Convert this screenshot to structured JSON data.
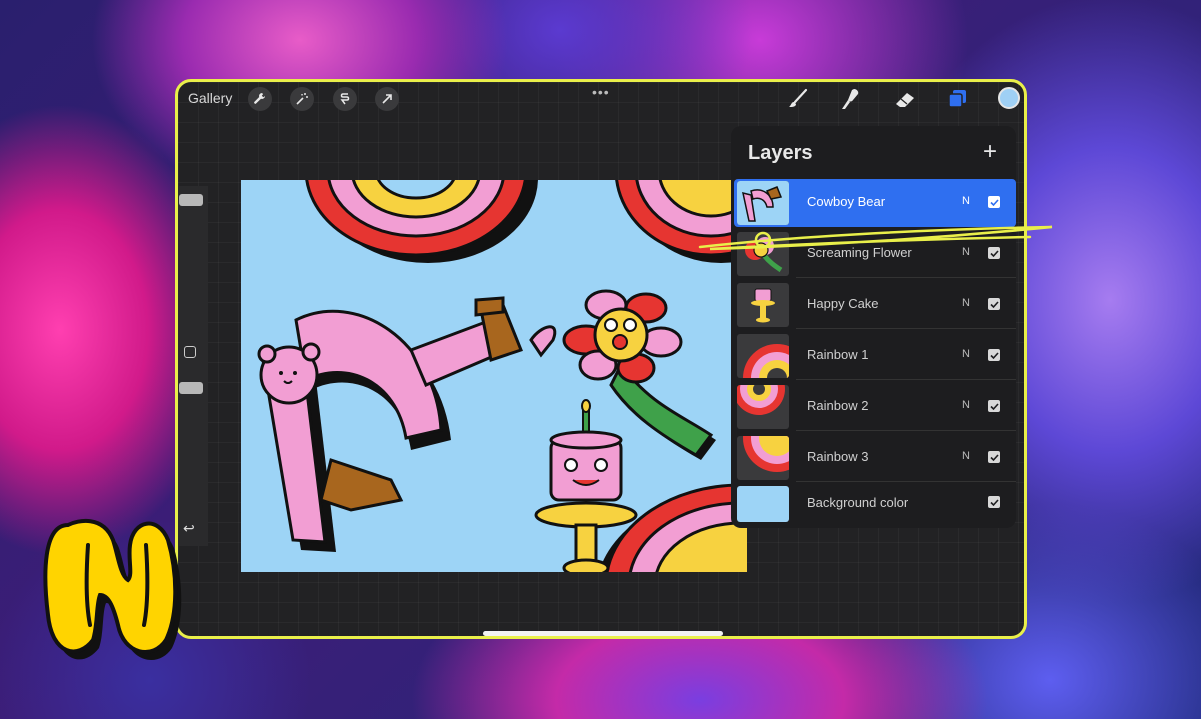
{
  "topbar": {
    "gallery_label": "Gallery",
    "left_tools": [
      "wrench-icon",
      "magic-wand-icon",
      "selection-icon",
      "transform-arrow-icon"
    ],
    "more_label": "•••",
    "right_tools": [
      "brush-icon",
      "smudge-icon",
      "eraser-icon",
      "layers-icon"
    ],
    "current_color": "#9fd0f5"
  },
  "sidebar": {
    "undo_label": "↩"
  },
  "layers_panel": {
    "title": "Layers",
    "add_label": "+",
    "items": [
      {
        "name": "Cowboy Bear",
        "mode": "N",
        "visible": true,
        "selected": true
      },
      {
        "name": "Screaming Flower",
        "mode": "N",
        "visible": true,
        "selected": false
      },
      {
        "name": "Happy Cake",
        "mode": "N",
        "visible": true,
        "selected": false
      },
      {
        "name": "Rainbow 1",
        "mode": "N",
        "visible": true,
        "selected": false
      },
      {
        "name": "Rainbow 2",
        "mode": "N",
        "visible": true,
        "selected": false
      },
      {
        "name": "Rainbow 3",
        "mode": "N",
        "visible": true,
        "selected": false
      },
      {
        "name": "Background color",
        "mode": "",
        "visible": true,
        "selected": false
      }
    ]
  },
  "colors": {
    "frame_accent": "#e9ef4a",
    "selected_layer": "#2f6ff0",
    "canvas_background": "#9dd4f6",
    "logo_yellow": "#ffd400"
  }
}
